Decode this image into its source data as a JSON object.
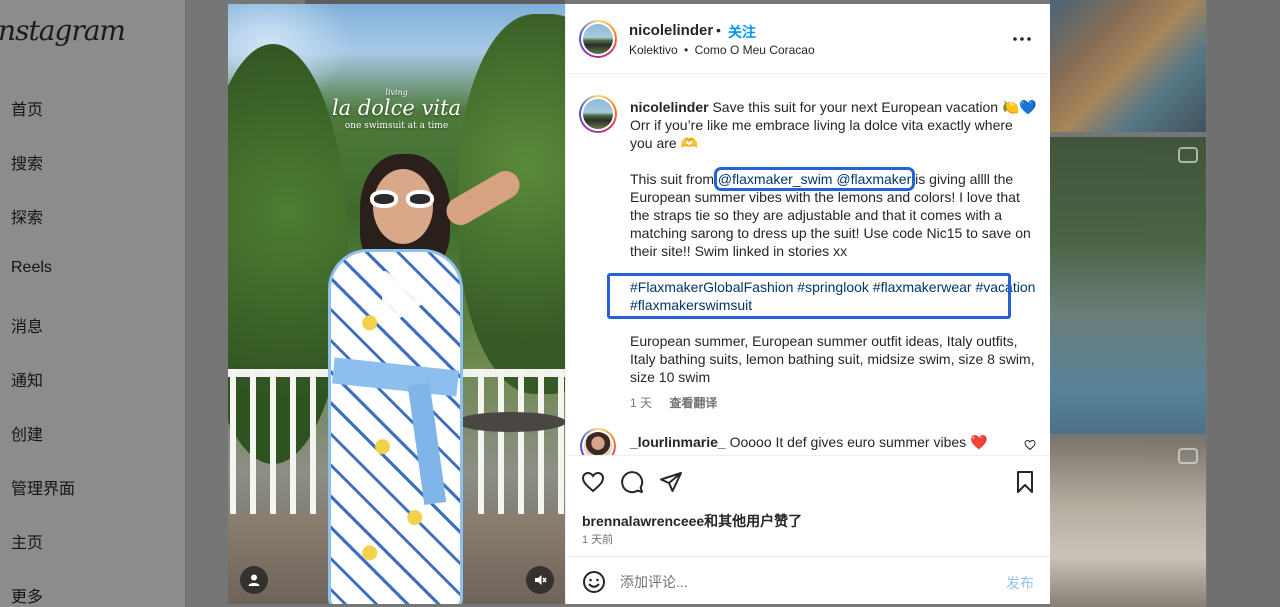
{
  "background": {
    "logo": "Instagram",
    "nav": [
      {
        "label": "首页"
      },
      {
        "label": "搜索"
      },
      {
        "label": "探索"
      },
      {
        "label": "Reels"
      },
      {
        "label": "消息"
      },
      {
        "label": "通知"
      },
      {
        "label": "创建"
      },
      {
        "label": "管理界面"
      },
      {
        "label": "主页"
      },
      {
        "label": "更多"
      }
    ]
  },
  "media": {
    "overlay_small": "living",
    "overlay_title": "la dolce vita",
    "overlay_sub": "one swimsuit at a time",
    "play_icon": "play-icon",
    "user_tag_icon": "user-icon",
    "mute_icon": "muted-speaker-icon"
  },
  "post": {
    "username": "nicolelinder",
    "dot": "•",
    "follow_label": "关注",
    "audio_artist": "Kolektivo",
    "audio_sep": "•",
    "audio_track": "Como O Meu Coracao",
    "more_icon": "more-horizontal-icon"
  },
  "caption": {
    "username": "nicolelinder",
    "line1": "Save this suit for your next European vacation 🍋💙 Orr if you’re like me embrace living la dolce vita exactly where you are 🫶",
    "p2_before": "This suit from ",
    "mentions": "@flaxmaker_swim @flaxmaker",
    "p2_after": " is giving allll the European summer vibes with the lemons and colors! I love that the straps tie so they are adjustable and that it comes with a matching sarong to dress up the suit! Use code Nic15 to save on their site!! Swim linked in stories xx",
    "hashtags": "#FlaxmakerGlobalFashion #springlook #flaxmakerwear #vacation #flaxmakerswimsuit",
    "keywords": "European summer, European summer outfit ideas, Italy outfits, Italy bathing suits, lemon bathing suit, midsize swim, size 8 swim, size 10 swim",
    "age": "1 天",
    "translate": "查看翻译"
  },
  "reply": {
    "username": "_lourlinmarie_",
    "text": "Ooooo It def gives euro summer vibes ❤️"
  },
  "actions": {
    "like_icon": "heart-icon",
    "comment_icon": "comment-icon",
    "share_icon": "send-icon",
    "save_icon": "bookmark-icon",
    "likes_text": "brennalawrenceee和其他用户赞了",
    "time_text": "1 天前"
  },
  "comment_box": {
    "emoji_icon": "emoji-icon",
    "placeholder": "添加评论...",
    "post_label": "发布"
  },
  "colors": {
    "accent_blue": "#0095f6",
    "link_navy": "#00376b",
    "highlight_box": "#2463d6",
    "post_disabled": "#93c1ef"
  }
}
